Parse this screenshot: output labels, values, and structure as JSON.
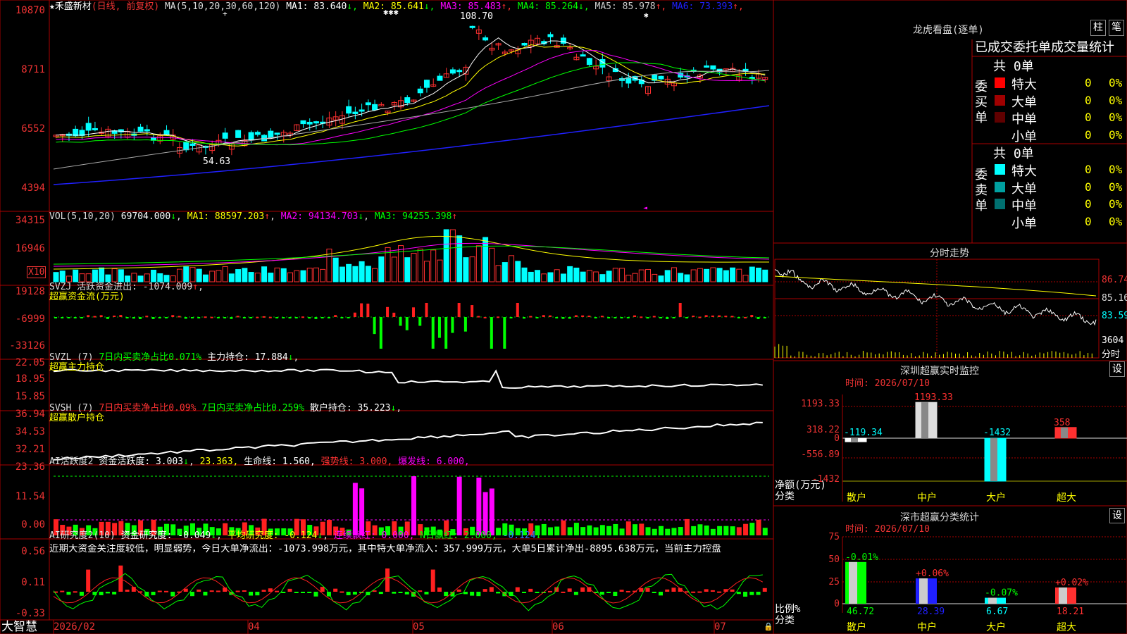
{
  "colors": {
    "up": "#ff3030",
    "down": "#00ffff",
    "grid": "#a00",
    "text": "#ddd",
    "yellow": "#ffff00",
    "magenta": "#ff00ff",
    "green": "#00ff00",
    "blue": "#2020ff"
  },
  "main_chart": {
    "star": "★",
    "stock_name": "禾盛新材",
    "mode": "(日线, 前复权)",
    "ma_params": "MA(5,10,20,30,60,120)",
    "ma_values": [
      {
        "label": "MA1:",
        "value": "83.640",
        "arrow": "↓",
        "color": "#ffffff"
      },
      {
        "label": "MA2:",
        "value": "85.641",
        "arrow": "↓",
        "color": "#ffff00"
      },
      {
        "label": "MA3:",
        "value": "85.483",
        "arrow": "↑",
        "color": "#ff00ff"
      },
      {
        "label": "MA4:",
        "value": "85.264",
        "arrow": "↓",
        "color": "#00ff00"
      },
      {
        "label": "MA5:",
        "value": "85.978",
        "arrow": "↑",
        "color": "#cccccc"
      },
      {
        "label": "MA6:",
        "value": "73.393",
        "arrow": "↑",
        "color": "#2020ff"
      }
    ],
    "y_labels": [
      "10870",
      "8711",
      "6552",
      "4394"
    ],
    "high_label": "108.70",
    "low_label": "54.63",
    "markers": "✱✱✱"
  },
  "vol": {
    "header": "VOL(5,10,20)",
    "value": "69704.000",
    "arrow": "↓",
    "ma1": "MA1: 88597.203",
    "ma1_arrow": "↑",
    "ma2": "MA2: 94134.703",
    "ma2_arrow": "↓",
    "ma3": "MA3: 94255.398",
    "ma3_arrow": "↑",
    "y_labels": [
      "34315",
      "16946"
    ],
    "unit": "X10"
  },
  "svzj": {
    "header": "SVZJ  活跃资金进出: -1074.009",
    "arrow": "↑",
    "line2": "超赢资金流(万元)",
    "y_labels": [
      "19128",
      "-6999",
      "-33126"
    ]
  },
  "svzl": {
    "header": "SVZL (7)",
    "t1": "7日内买卖净占比0.071%",
    "t2": "主力持仓: 17.884",
    "arrow": "↓",
    "line2": "超赢主力持仓",
    "y_labels": [
      "22.05",
      "18.95",
      "15.85"
    ]
  },
  "svsh": {
    "header": "SVSH (7)",
    "t1": "7日内买卖净占比0.09%",
    "t2": "7日内买卖净占比0.259%",
    "t3": "散户持仓: 35.223",
    "arrow": "↓",
    "line2": "超赢散户持仓",
    "y_labels": [
      "36.94",
      "34.53",
      "32.21"
    ]
  },
  "ai_active": {
    "header": "AI活跃度2",
    "t1": "资金活跃度: 3.003",
    "a1": "↓",
    "t2": "23.363,",
    "t3": "生命线: 1.560,",
    "t4": "强势线: 3.000,",
    "t5": "爆发线: 6.000,",
    "y_labels": [
      "23.36",
      "11.54",
      "0.00"
    ]
  },
  "ai_research": {
    "header": "AI研究度2(10)",
    "t1": "资金研究度: -0.049",
    "a1": "↓",
    "t2": "平均研究度: -0.124",
    "a2": "↓",
    "t3": "连续飘红: 0.000,",
    "t4": "N日飘红: 2.000,",
    "t5": "-0.124",
    "a5": "↓",
    "comment": "近期大资金关注度较低，明显弱势，今日大单净流出：-1073.998万元，其中特大单净流入：357.999万元，大单5日累计净出-8895.638万元，当前主力控盘",
    "y_labels": [
      "0.56",
      "0.11",
      "-0.33"
    ]
  },
  "bottom": {
    "brand": "大智慧",
    "dates": [
      "2026/02",
      "04",
      "05",
      "06",
      "07"
    ]
  },
  "longhu": {
    "title": "龙虎看盘(逐单)",
    "btn1": "柱",
    "btn2": "笔",
    "header": "已成交委托单成交量统计",
    "buy_label": "委买单",
    "sell_label": "委卖单",
    "buy_total": "共 0单",
    "sell_total": "共 0单",
    "buy_rows": [
      {
        "name": "特大",
        "count": "0",
        "pct": "0%",
        "color": "#ff0000"
      },
      {
        "name": "大单",
        "count": "0",
        "pct": "0%",
        "color": "#a00000"
      },
      {
        "name": "中单",
        "count": "0",
        "pct": "0%",
        "color": "#600000"
      },
      {
        "name": "小单",
        "count": "0",
        "pct": "0%",
        "color": "#000000"
      }
    ],
    "sell_rows": [
      {
        "name": "特大",
        "count": "0",
        "pct": "0%",
        "color": "#00ffff"
      },
      {
        "name": "大单",
        "count": "0",
        "pct": "0%",
        "color": "#00a0a0"
      },
      {
        "name": "中单",
        "count": "0",
        "pct": "0%",
        "color": "#007070"
      },
      {
        "name": "小单",
        "count": "0",
        "pct": "0%",
        "color": "#000000"
      }
    ]
  },
  "intraday": {
    "title": "分时走势",
    "y_labels": [
      "86.74",
      "85.16",
      "83.59"
    ],
    "vol_label": "3604",
    "vol_unit": "分时"
  },
  "sz_monitor": {
    "title": "深圳超赢实时监控",
    "btn": "设",
    "time": "时间: 2026/07/10",
    "ylabel1": "净额(万元)",
    "ylabel2": "分类",
    "y_labels": [
      "1193.33",
      "318.22",
      "0",
      "-556.89",
      "-1432"
    ],
    "categories": [
      "散户",
      "中户",
      "大户",
      "超大"
    ],
    "values": [
      "-119.34",
      "1193.33",
      "-1432",
      "358"
    ]
  },
  "sz_class": {
    "title": "深市超赢分类统计",
    "btn": "设",
    "time": "时间: 2026/07/10",
    "ylabel1": "比例%",
    "ylabel2": "分类",
    "y_labels": [
      "75",
      "50",
      "25",
      "0"
    ],
    "categories": [
      "散户",
      "中户",
      "大户",
      "超大"
    ],
    "changes": [
      "-0.01%",
      "+0.06%",
      "-0.07%",
      "+0.02%"
    ],
    "values": [
      "46.72",
      "28.39",
      "6.67",
      "18.21"
    ]
  }
}
